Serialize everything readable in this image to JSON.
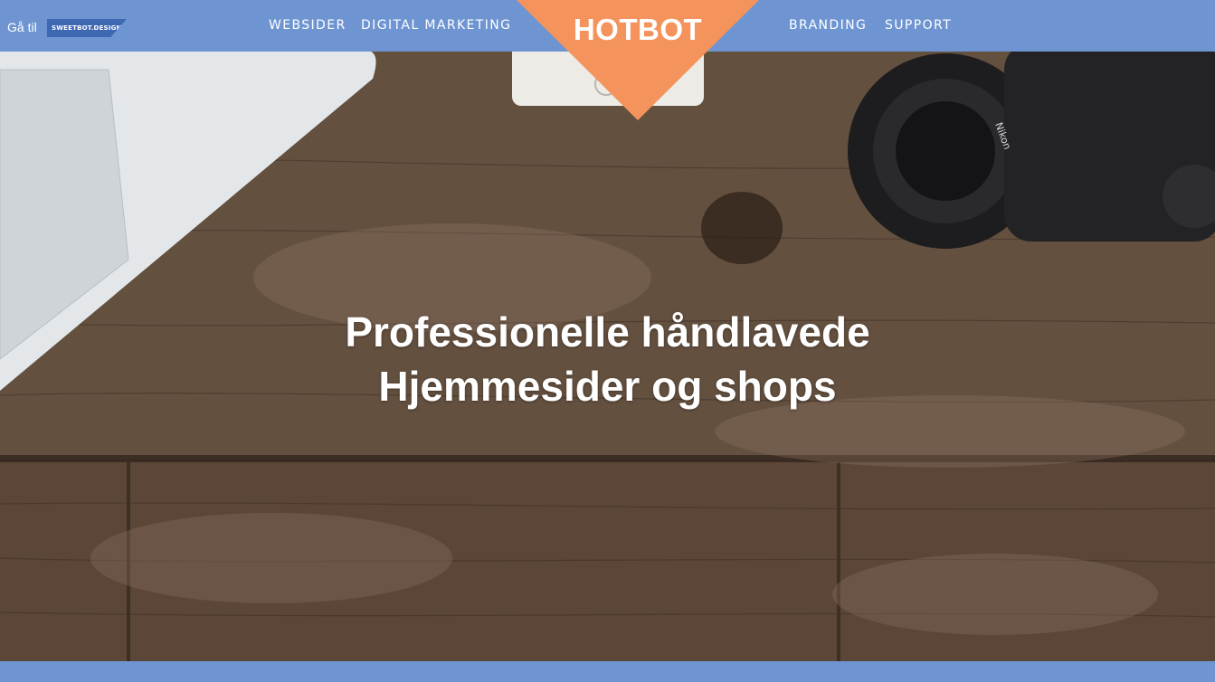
{
  "header": {
    "goto_label": "Gå til",
    "goto_badge": "SWEETBOT.DESIGN",
    "nav_left": [
      "WEBSIDER",
      "DIGITAL MARKETING"
    ],
    "logo_text": "HOTBOT",
    "nav_right": [
      "BRANDING",
      "SUPPORT"
    ]
  },
  "hero": {
    "title_line1": "Professionelle håndlavede",
    "title_line2": "Hjemmesider og shops"
  },
  "colors": {
    "bar": "#6e95d2",
    "logo": "#f4935c",
    "badge": "#3f68b3"
  }
}
